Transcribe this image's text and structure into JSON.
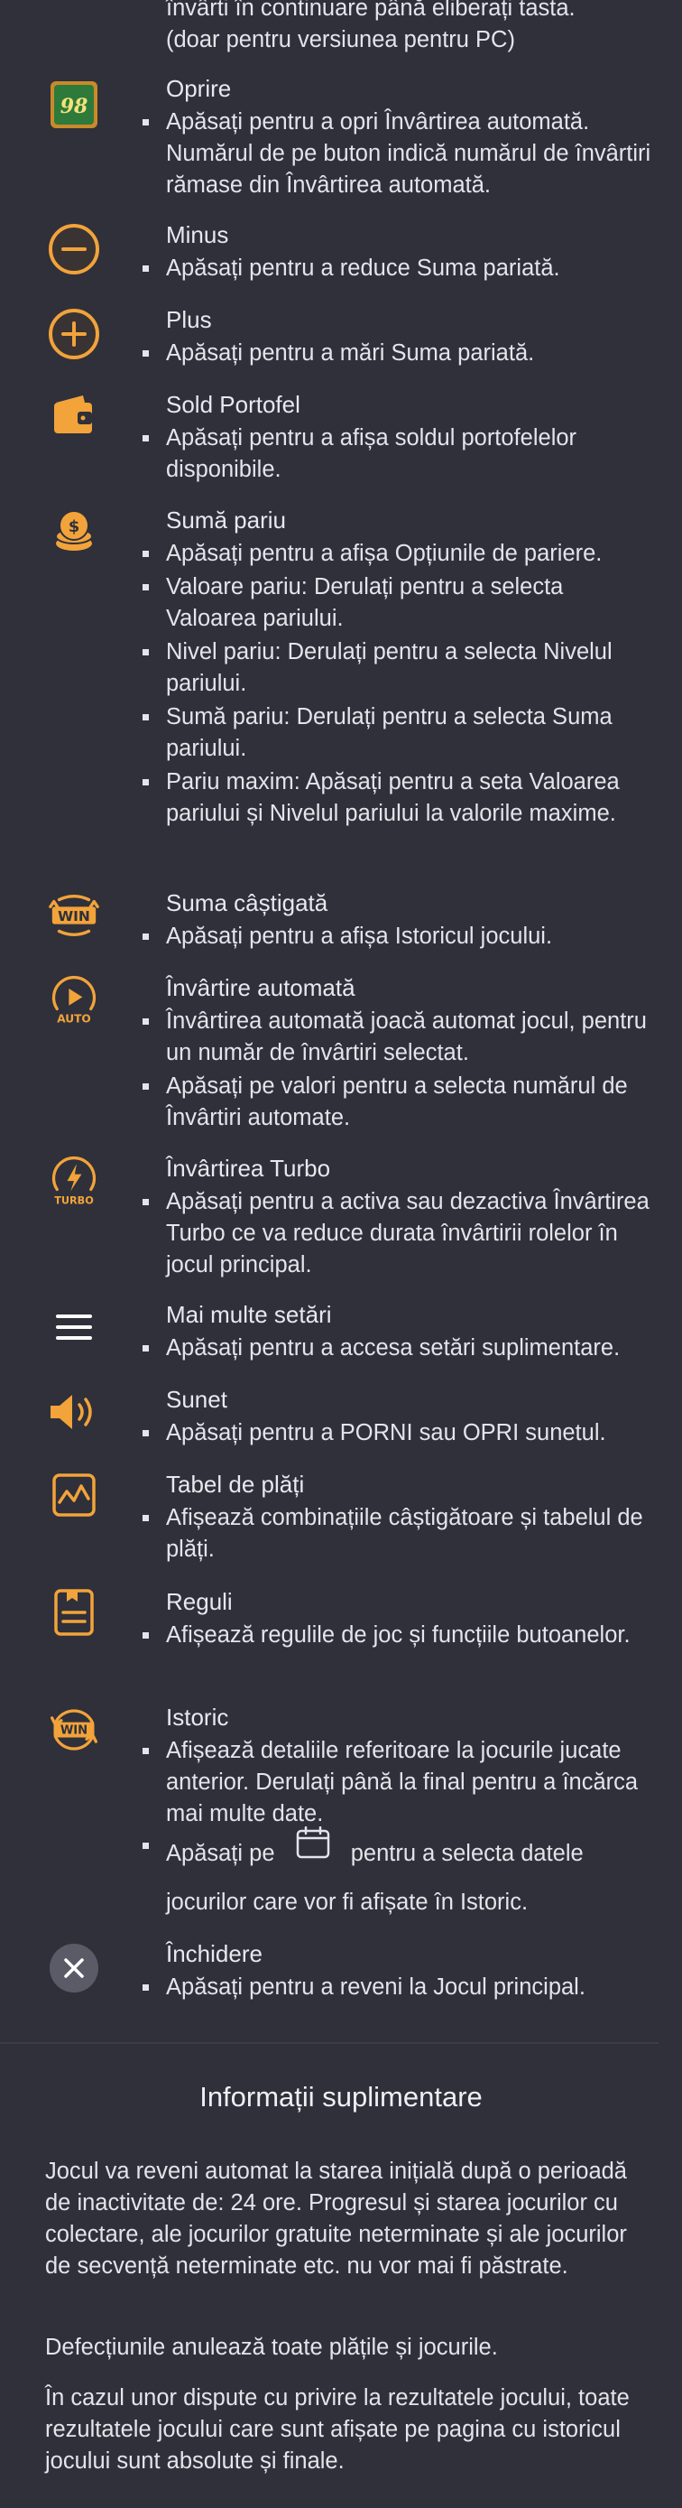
{
  "top_text": {
    "line1": "învârti în continuare până eliberați tasta.",
    "line2": "(doar pentru versiunea pentru PC)"
  },
  "items": [
    {
      "icon": "stop-autospin-icon",
      "badge": "98",
      "title": "Oprire",
      "bullets": [
        "Apăsați pentru a opri Învârtirea automată. Numărul de pe buton indică numărul de învârtiri rămase din Învârtirea automată."
      ]
    },
    {
      "icon": "minus-icon",
      "title": "Minus",
      "bullets": [
        "Apăsați pentru a reduce Suma pariată."
      ]
    },
    {
      "icon": "plus-icon",
      "title": "Plus",
      "bullets": [
        "Apăsați pentru a mări Suma pariată."
      ]
    },
    {
      "icon": "wallet-icon",
      "title": "Sold Portofel",
      "bullets": [
        "Apăsați pentru a afișa soldul portofelelor disponibile."
      ]
    },
    {
      "icon": "coins-icon",
      "title": "Sumă pariu",
      "bullets": [
        "Apăsați pentru a afișa Opțiunile de pariere.",
        "Valoare pariu: Derulați pentru a selecta Valoarea pariului.",
        "Nivel pariu: Derulați pentru a selecta Nivelul pariului.",
        "Sumă pariu: Derulați pentru a selecta Suma pariului.",
        "Pariu maxim: Apăsați pentru a seta Valoarea pariului și Nivelul pariului la valorile maxime."
      ]
    },
    {
      "icon": "win-icon",
      "badge": "WIN",
      "title": "Suma câștigată",
      "bullets": [
        "Apăsați pentru a afișa Istoricul jocului."
      ]
    },
    {
      "icon": "autoplay-icon",
      "badge": "AUTO",
      "title": "Învârtire automată",
      "bullets": [
        "Învârtirea automată joacă automat jocul, pentru un număr de învârtiri selectat.",
        "Apăsați pe valori pentru a selecta numărul de Învârtiri automate."
      ]
    },
    {
      "icon": "turbo-icon",
      "badge": "TURBO",
      "title": "Învârtirea Turbo",
      "bullets": [
        "Apăsați pentru a activa sau dezactiva Învârtirea Turbo ce va reduce durata învârtirii rolelor în jocul principal."
      ]
    },
    {
      "icon": "menu-icon",
      "title": "Mai multe setări",
      "bullets": [
        "Apăsați pentru a accesa setări suplimentare."
      ]
    },
    {
      "icon": "sound-icon",
      "title": "Sunet",
      "bullets": [
        "Apăsați pentru a PORNI sau OPRI sunetul."
      ]
    },
    {
      "icon": "paytable-icon",
      "title": "Tabel de plăți",
      "bullets": [
        "Afișează combinațiile câștigătoare și tabelul de plăți."
      ]
    },
    {
      "icon": "rules-icon",
      "title": "Reguli",
      "bullets": [
        "Afișează regulile de joc și funcțiile butoanelor."
      ]
    },
    {
      "icon": "history-icon",
      "badge": "WIN",
      "title": "Istoric",
      "bullets": [
        "Afișează detaliile referitoare la jocurile jucate anterior. Derulați până la final pentru a încărca mai multe date."
      ],
      "calendar_bullet": {
        "before": "Apăsați pe",
        "after": "pentru a selecta datele",
        "line2": "jocurilor care vor fi afișate în Istoric."
      }
    },
    {
      "icon": "close-icon",
      "title": "Închidere",
      "bullets": [
        "Apăsați pentru a reveni la Jocul principal."
      ]
    }
  ],
  "additional": {
    "title": "Informații suplimentare",
    "paragraphs": [
      "Jocul va reveni automat la starea inițială după o perioadă de inactivitate de: 24 ore. Progresul și starea jocurilor cu colectare, ale jocurilor gratuite neterminate și ale jocurilor de secvență neterminate etc. nu vor mai fi păstrate.",
      "Defecțiunile anulează toate plățile și jocurile.",
      "În cazul unor dispute cu privire la rezultatele jocului, toate rezultatele jocului care sunt afișate pe pagina cu istoricul jocului sunt absolute și finale."
    ]
  },
  "colors": {
    "background": "#2f303a",
    "accent": "#f2a33a",
    "text": "#e4e4ea",
    "badge_green": "#2e7a3a"
  }
}
